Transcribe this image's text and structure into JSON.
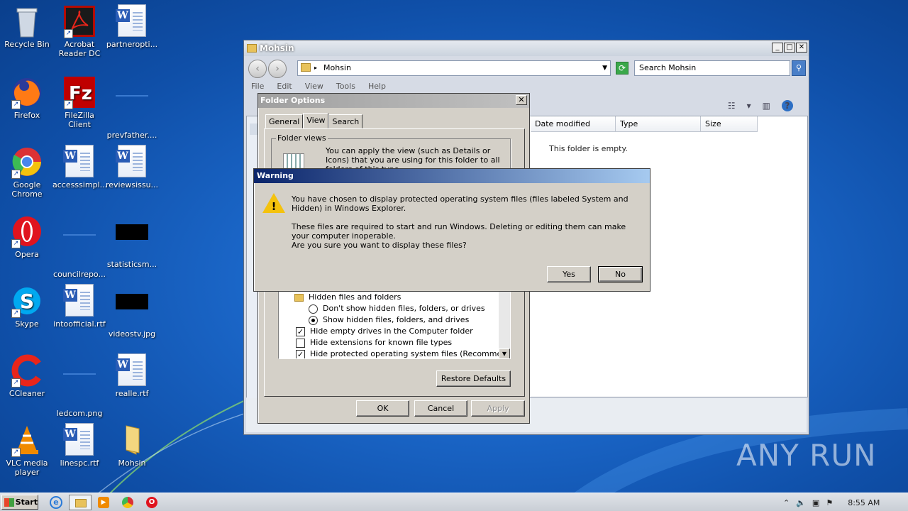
{
  "desktop": {
    "icons": [
      {
        "label": "Recycle Bin"
      },
      {
        "label": "Acrobat Reader DC"
      },
      {
        "label": "partneropti..."
      },
      {
        "label": "Firefox"
      },
      {
        "label": "FileZilla Client"
      },
      {
        "label": "prevfather...."
      },
      {
        "label": "Google Chrome"
      },
      {
        "label": "accesssimpl..."
      },
      {
        "label": "reviewsissu..."
      },
      {
        "label": "Opera"
      },
      {
        "label": "councilrepo..."
      },
      {
        "label": "statisticsm..."
      },
      {
        "label": "Skype"
      },
      {
        "label": "intoofficial.rtf"
      },
      {
        "label": "videostv.jpg"
      },
      {
        "label": "CCleaner"
      },
      {
        "label": "ledcom.png"
      },
      {
        "label": "realle.rtf"
      },
      {
        "label": "VLC media player"
      },
      {
        "label": "linespc.rtf"
      },
      {
        "label": "Mohsin"
      }
    ]
  },
  "explorer": {
    "title": "Mohsin",
    "address": "Mohsin",
    "search_placeholder": "Search Mohsin",
    "menu": [
      "File",
      "Edit",
      "View",
      "Tools",
      "Help"
    ],
    "columns": [
      "Date modified",
      "Type",
      "Size"
    ],
    "empty_text": "This folder is empty."
  },
  "folder_options": {
    "title": "Folder Options",
    "close": "✕",
    "tabs": [
      "General",
      "View",
      "Search"
    ],
    "folder_views_legend": "Folder views",
    "folder_views_text": "You can apply the view (such as Details or Icons) that you are using for this folder to all folders of this type.",
    "settings": {
      "hidden_group": "Hidden files and folders",
      "dont_show": "Don't show hidden files, folders, or drives",
      "show": "Show hidden files, folders, and drives",
      "hide_empty": "Hide empty drives in the Computer folder",
      "hide_ext": "Hide extensions for known file types",
      "hide_protected": "Hide protected operating system files (Recommended)"
    },
    "restore_defaults": "Restore Defaults",
    "ok": "OK",
    "cancel": "Cancel",
    "apply": "Apply"
  },
  "warning": {
    "title": "Warning",
    "line1": "You have chosen to display protected operating system files (files labeled System and Hidden) in Windows Explorer.",
    "line2": "These files are required to start and run Windows. Deleting or editing them can make your computer inoperable.",
    "line3": "Are you sure you want to display these files?",
    "yes": "Yes",
    "no": "No"
  },
  "taskbar": {
    "start": "Start",
    "clock": "8:55 AM"
  },
  "watermark": "ANY RUN"
}
